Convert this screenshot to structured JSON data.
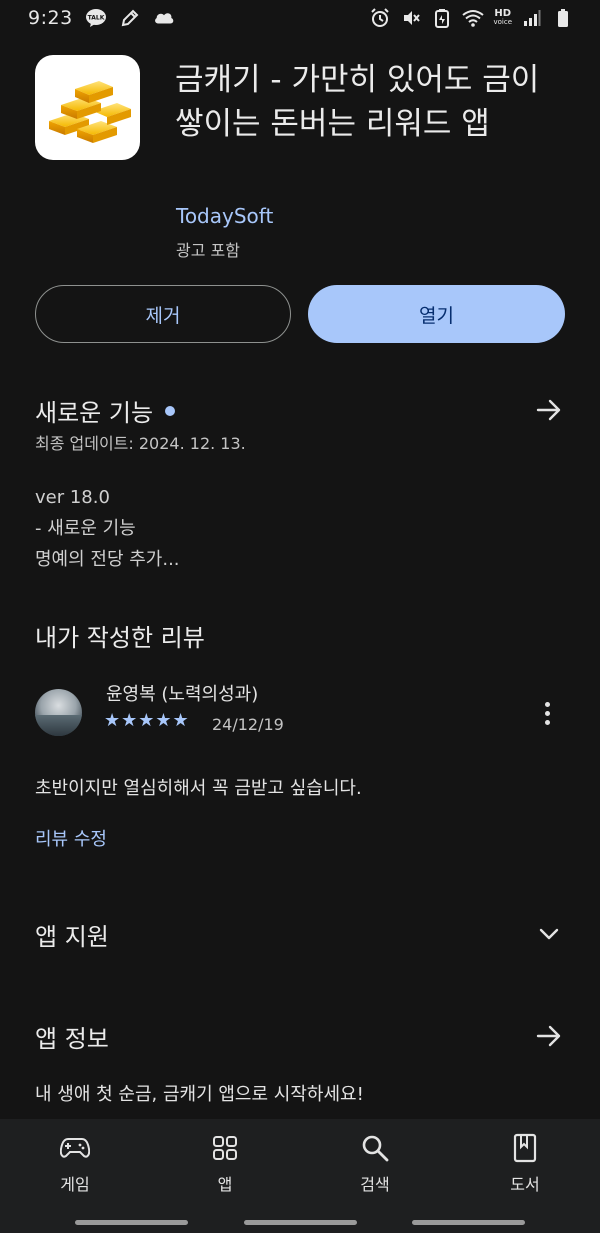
{
  "status_bar": {
    "time": "9:23",
    "left_icons": [
      "kakaotalk-icon",
      "pencil-icon",
      "cloud-icon"
    ],
    "right_icons": [
      "alarm-icon",
      "mute-icon",
      "battery-saver-icon",
      "wifi-icon",
      "hd-voice-icon",
      "signal-icon",
      "battery-icon"
    ],
    "hd_top": "HD",
    "hd_bottom": "voice"
  },
  "app": {
    "title": "금캐기 - 가만히 있어도 금이 쌓이는 돈버는 리워드 앱",
    "developer": "TodaySoft",
    "ads_label": "광고 포함",
    "icon": "gold-bars-icon"
  },
  "buttons": {
    "remove": "제거",
    "open": "열기"
  },
  "whats_new": {
    "title": "새로운 기능",
    "updated": "최종 업데이트: 2024. 12. 13.",
    "notes": [
      "ver 18.0",
      "- 새로운 기능",
      "명예의 전당 추가..."
    ]
  },
  "my_review": {
    "title": "내가 작성한 리뷰",
    "reviewer": "윤영복 (노력의성과)",
    "rating": 5,
    "stars": "★★★★★",
    "date": "24/12/19",
    "text": "초반이지만 열심히해서 꼭 금받고 싶습니다.",
    "edit_label": "리뷰 수정"
  },
  "app_support": {
    "title": "앱 지원"
  },
  "app_info": {
    "title": "앱 정보",
    "description": "내 생애 첫 순금, 금캐기 앱으로 시작하세요!"
  },
  "bottom_nav": {
    "items": [
      {
        "label": "게임",
        "icon": "gamepad-icon"
      },
      {
        "label": "앱",
        "icon": "apps-grid-icon"
      },
      {
        "label": "검색",
        "icon": "search-icon"
      },
      {
        "label": "도서",
        "icon": "book-icon"
      }
    ]
  },
  "colors": {
    "background": "#141414",
    "accent": "#a8c7fa",
    "nav_background": "#1e1f20"
  }
}
